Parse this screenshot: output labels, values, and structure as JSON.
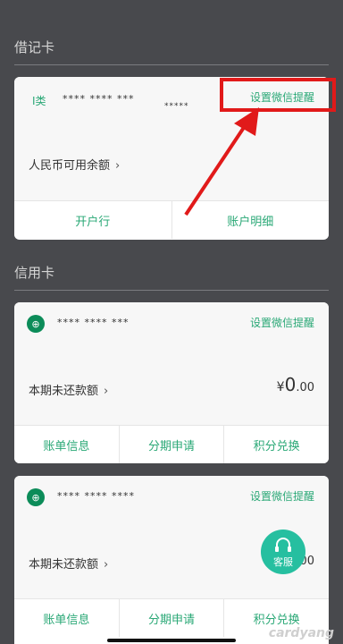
{
  "debit_section": {
    "title": "借记卡"
  },
  "debit_card": {
    "type_label": "Ⅰ类",
    "masked_number": "**** **** *** ",
    "masked_number_tail": "*****",
    "wechat_reminder": "设置微信提醒",
    "balance_label": "人民币可用余额",
    "actions": [
      "开户行",
      "账户明细"
    ]
  },
  "credit_section": {
    "title": "信用卡"
  },
  "credit_cards": [
    {
      "masked_number": "**** **** ***",
      "wechat_reminder": "设置微信提醒",
      "due_label": "本期未还款额",
      "amount_symbol": "¥",
      "amount_int": "0",
      "amount_dec": ".00",
      "actions": [
        "账单信息",
        "分期申请",
        "积分兑换"
      ]
    },
    {
      "masked_number": "**** **** ****",
      "wechat_reminder": "设置微信提醒",
      "due_label": "本期未还款额",
      "amount_symbol": "",
      "amount_int": "",
      "amount_dec": ".00",
      "actions": [
        "账单信息",
        "分期申请",
        "积分兑换"
      ]
    }
  ],
  "customer_service": {
    "label": "客服"
  },
  "watermark": "cardyang",
  "colors": {
    "accent": "#2aa876",
    "annotation": "#e11a1a",
    "background": "#48494d"
  }
}
